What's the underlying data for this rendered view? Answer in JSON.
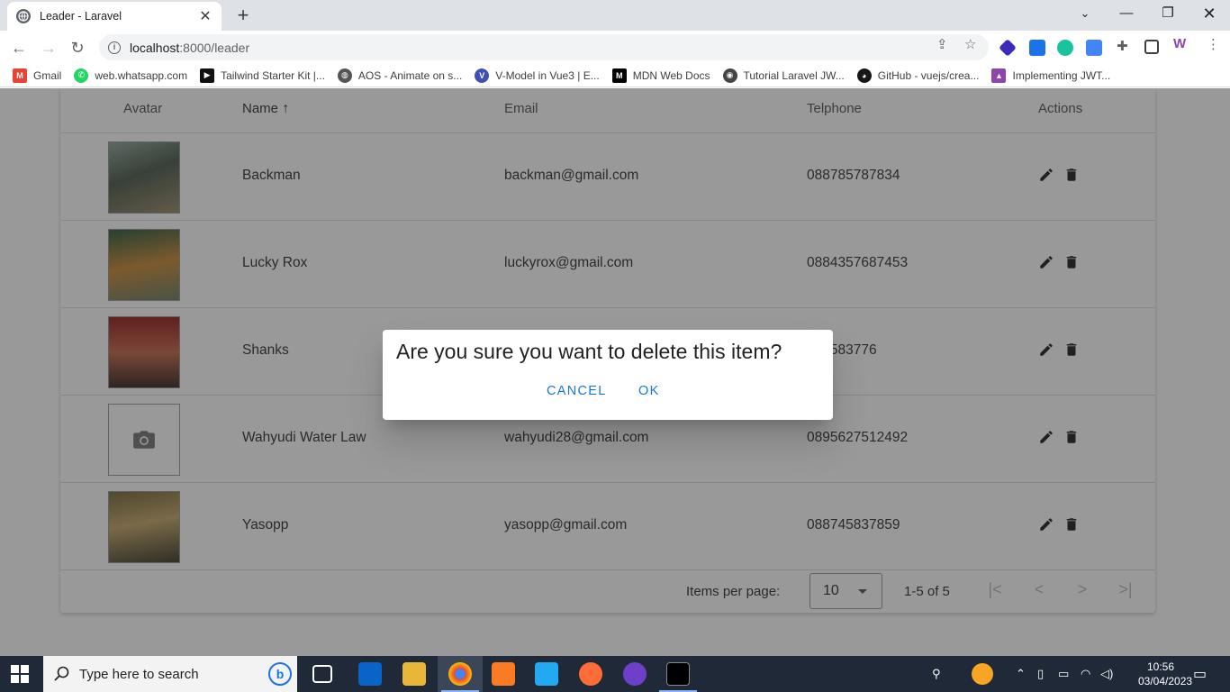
{
  "browser": {
    "tab_title": "Leader - Laravel",
    "url_host": "localhost",
    "url_path": ":8000/leader"
  },
  "bookmarks": [
    {
      "label": "Gmail",
      "color": "#ea4335",
      "icon": "gmail-icon"
    },
    {
      "label": "web.whatsapp.com",
      "color": "#25d366",
      "icon": "whatsapp-icon"
    },
    {
      "label": "Tailwind Starter Kit |...",
      "color": "#111111",
      "icon": "tailwind-icon"
    },
    {
      "label": "AOS - Animate on s...",
      "color": "#555555",
      "icon": "globe-icon"
    },
    {
      "label": "V-Model in Vue3 | E...",
      "color": "#3f51b5",
      "icon": "vue-icon"
    },
    {
      "label": "MDN Web Docs",
      "color": "#000000",
      "icon": "mdn-icon"
    },
    {
      "label": "Tutorial Laravel JW...",
      "color": "#444444",
      "icon": "tutorial-icon"
    },
    {
      "label": "GitHub - vuejs/crea...",
      "color": "#181717",
      "icon": "github-icon"
    },
    {
      "label": "Implementing JWT...",
      "color": "#8e44ad",
      "icon": "jwt-icon"
    }
  ],
  "table": {
    "headers": {
      "avatar": "Avatar",
      "name": "Name",
      "email": "Email",
      "phone": "Telphone",
      "actions": "Actions"
    },
    "rows": [
      {
        "name": "Backman",
        "email": "backman@gmail.com",
        "phone": "088785787834",
        "avatar": "backman",
        "avatar_color": "#6b7f6a"
      },
      {
        "name": "Lucky Rox",
        "email": "luckyrox@gmail.com",
        "phone": "0884357687453",
        "avatar": "luckyrox",
        "avatar_color": "#3f6b4a"
      },
      {
        "name": "Shanks",
        "email": "",
        "phone": "787583776",
        "avatar": "shanks",
        "avatar_color": "#8a2b2b"
      },
      {
        "name": "Wahyudi Water Law",
        "email": "wahyudi28@gmail.com",
        "phone": "0895627512492",
        "avatar": "placeholder",
        "avatar_color": "#ffffff"
      },
      {
        "name": "Yasopp",
        "email": "yasopp@gmail.com",
        "phone": "088745837859",
        "avatar": "yasopp",
        "avatar_color": "#6a6a44"
      }
    ]
  },
  "footer": {
    "items_per_page_label": "Items per page:",
    "items_per_page_value": "10",
    "range": "1-5 of 5"
  },
  "dialog": {
    "title": "Are you sure you want to delete this item?",
    "cancel": "Cancel",
    "ok": "OK"
  },
  "taskbar": {
    "search_placeholder": "Type here to search",
    "time": "10:56",
    "date": "03/04/2023"
  }
}
